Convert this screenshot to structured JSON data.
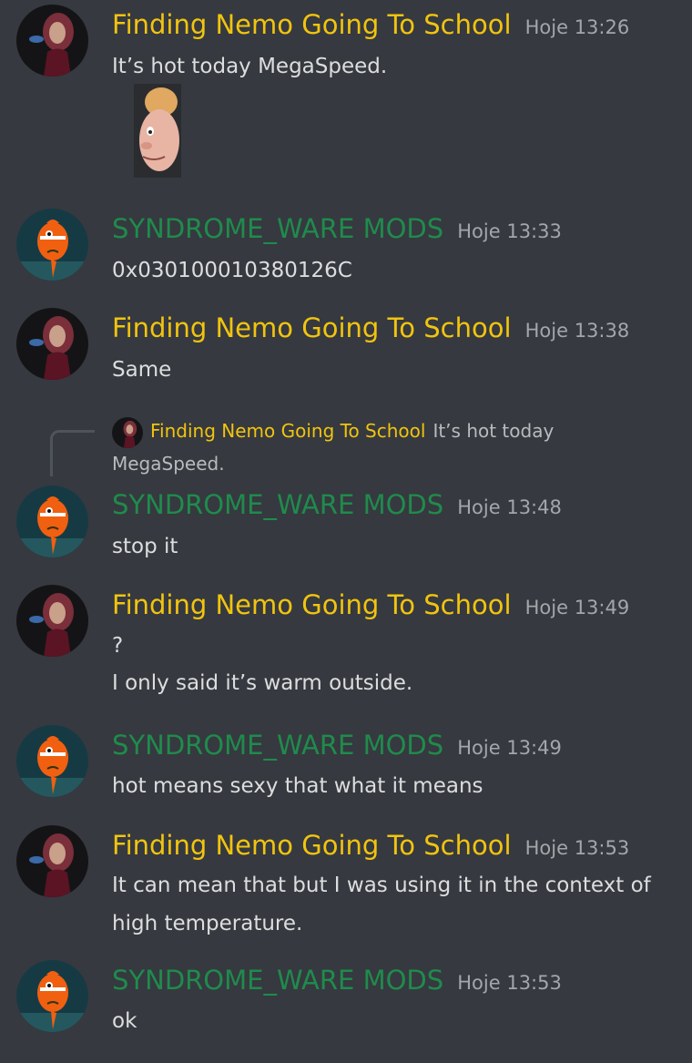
{
  "users": {
    "finding_nemo": {
      "name": "Finding Nemo Going To School",
      "color": "#f1c40f",
      "avatar_icon": "woman-portrait-avatar"
    },
    "syndrome": {
      "name": "SYNDROME_WARE MODS",
      "color": "#1f8b4c",
      "avatar_icon": "orange-fish-avatar"
    }
  },
  "messages": [
    {
      "author": "Finding Nemo Going To School",
      "time": "Hoje 13:26",
      "lines": [
        "It’s hot today MegaSpeed."
      ],
      "attachment": "cartoon-face-image"
    },
    {
      "author": "SYNDROME_WARE MODS",
      "time": "Hoje 13:33",
      "lines": [
        "0x030100010380126C"
      ]
    },
    {
      "author": "Finding Nemo Going To School",
      "time": "Hoje 13:38",
      "lines": [
        "Same"
      ]
    },
    {
      "author": "SYNDROME_WARE MODS",
      "time": "Hoje 13:48",
      "lines": [
        "stop it"
      ],
      "reply": {
        "author": "Finding Nemo Going To School",
        "text": "It’s hot today MegaSpeed."
      }
    },
    {
      "author": "Finding Nemo Going To School",
      "time": "Hoje 13:49",
      "lines": [
        "?",
        "I only said it’s warm outside."
      ]
    },
    {
      "author": "SYNDROME_WARE MODS",
      "time": "Hoje 13:49",
      "lines": [
        "hot means sexy that what it means"
      ]
    },
    {
      "author": "Finding Nemo Going To School",
      "time": "Hoje 13:53",
      "lines": [
        "It can mean that but I was using it in the context of",
        "high temperature."
      ]
    },
    {
      "author": "SYNDROME_WARE MODS",
      "time": "Hoje 13:53",
      "lines": [
        "ok"
      ]
    }
  ]
}
